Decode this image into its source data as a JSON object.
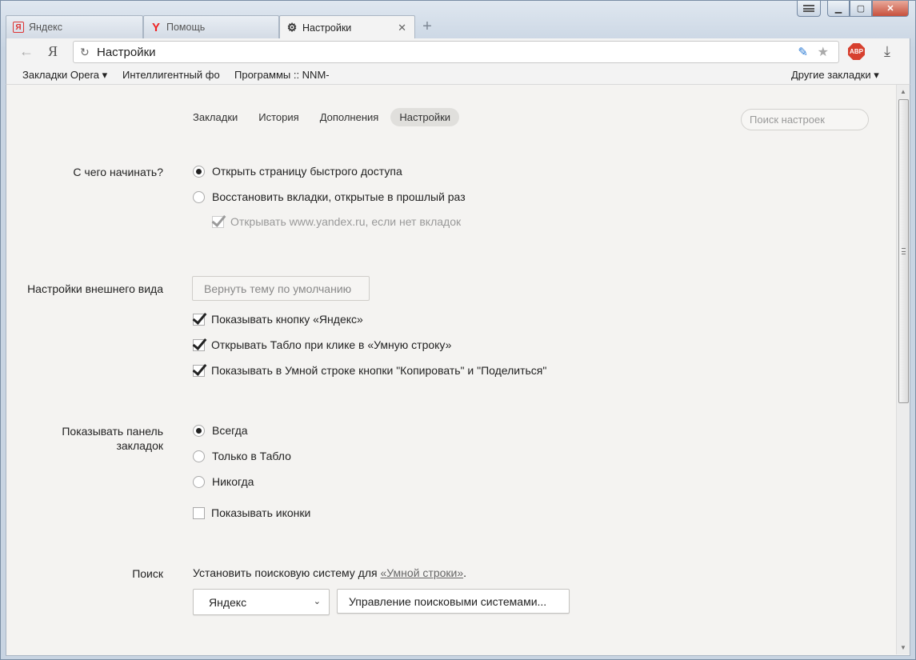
{
  "window": {
    "tabs": [
      {
        "label": "Яндекс",
        "icon": "yandex-icon"
      },
      {
        "label": "Помощь",
        "icon": "yandex-y-icon"
      },
      {
        "label": "Настройки",
        "icon": "gear-icon",
        "active": true
      }
    ],
    "new_tab": "+"
  },
  "toolbar": {
    "logo": "Я",
    "url": "Настройки"
  },
  "bookmarks_bar": {
    "items": [
      "Закладки Opera ▾",
      "Интеллигентный фо",
      "Программы :: NNM-"
    ],
    "other": "Другие закладки ▾"
  },
  "page_nav": {
    "items": [
      "Закладки",
      "История",
      "Дополнения",
      "Настройки"
    ],
    "active": "Настройки",
    "search_placeholder": "Поиск настроек"
  },
  "startup": {
    "label": "С чего начинать?",
    "options": [
      {
        "label": "Открыть страницу быстрого доступа",
        "checked": true
      },
      {
        "label": "Восстановить вкладки, открытые в прошлый раз",
        "checked": false
      }
    ],
    "sub_option": {
      "label": "Открывать www.yandex.ru, если нет вкладок",
      "checked": true,
      "disabled": true
    }
  },
  "appearance": {
    "label": "Настройки внешнего вида",
    "reset_theme_button": "Вернуть тему по умолчанию",
    "checkboxes": [
      {
        "label": "Показывать кнопку «Яндекс»",
        "checked": true
      },
      {
        "label": "Открывать Табло при клике в «Умную строку»",
        "checked": true
      },
      {
        "label": "Показывать в Умной строке кнопки \"Копировать\" и \"Поделиться\"",
        "checked": true
      }
    ]
  },
  "bookmarks_panel": {
    "label": "Показывать панель закладок",
    "options": [
      {
        "label": "Всегда",
        "checked": true
      },
      {
        "label": "Только в Табло",
        "checked": false
      },
      {
        "label": "Никогда",
        "checked": false
      }
    ],
    "show_icons": {
      "label": "Показывать иконки",
      "checked": false
    }
  },
  "search": {
    "label": "Поиск",
    "text_prefix": "Установить поисковую систему для ",
    "link": "«Умной строки»",
    "text_suffix": ".",
    "engine_selected": "Яндекс",
    "manage_button": "Управление поисковыми системами..."
  }
}
